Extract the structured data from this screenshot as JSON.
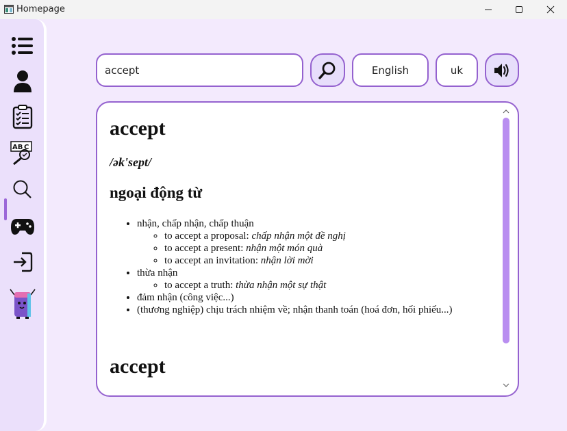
{
  "window": {
    "title": "Homepage"
  },
  "sidebar": {
    "items": [
      {
        "icon": "list-icon"
      },
      {
        "icon": "user-icon"
      },
      {
        "icon": "clipboard-icon"
      },
      {
        "icon": "spell-check-icon"
      },
      {
        "icon": "search-icon",
        "active": true
      },
      {
        "icon": "gamepad-icon"
      },
      {
        "icon": "logout-icon"
      },
      {
        "icon": "book-mascot-icon"
      }
    ]
  },
  "search": {
    "value": "accept",
    "language": "English",
    "accent": "uk"
  },
  "entry": {
    "word": "accept",
    "phonetic": "/ək'sept/",
    "part_of_speech": "ngoại động từ",
    "senses": [
      {
        "text": "nhận, chấp nhận, chấp thuận",
        "examples": [
          {
            "en": "to accept a proposal:",
            "vi": "chấp nhận một đề nghị"
          },
          {
            "en": "to accept a present:",
            "vi": "nhận một món quà"
          },
          {
            "en": "to accept an invitation:",
            "vi": "nhận lời mời"
          }
        ]
      },
      {
        "text": "thừa nhận",
        "examples": [
          {
            "en": "to accept a truth:",
            "vi": "thừa nhận một sự thật"
          }
        ]
      },
      {
        "text": "đảm nhận (công việc...)",
        "examples": []
      },
      {
        "text": "(thương nghiệp) chịu trách nhiệm về; nhận thanh toán (hoá đơn, hối phiếu...)",
        "examples": []
      }
    ],
    "next_word": "accept"
  },
  "colors": {
    "accent": "#9461cf",
    "background": "#f3eafd",
    "sidebar": "#ebe0fb",
    "scroll_thumb": "#b98ef0"
  }
}
